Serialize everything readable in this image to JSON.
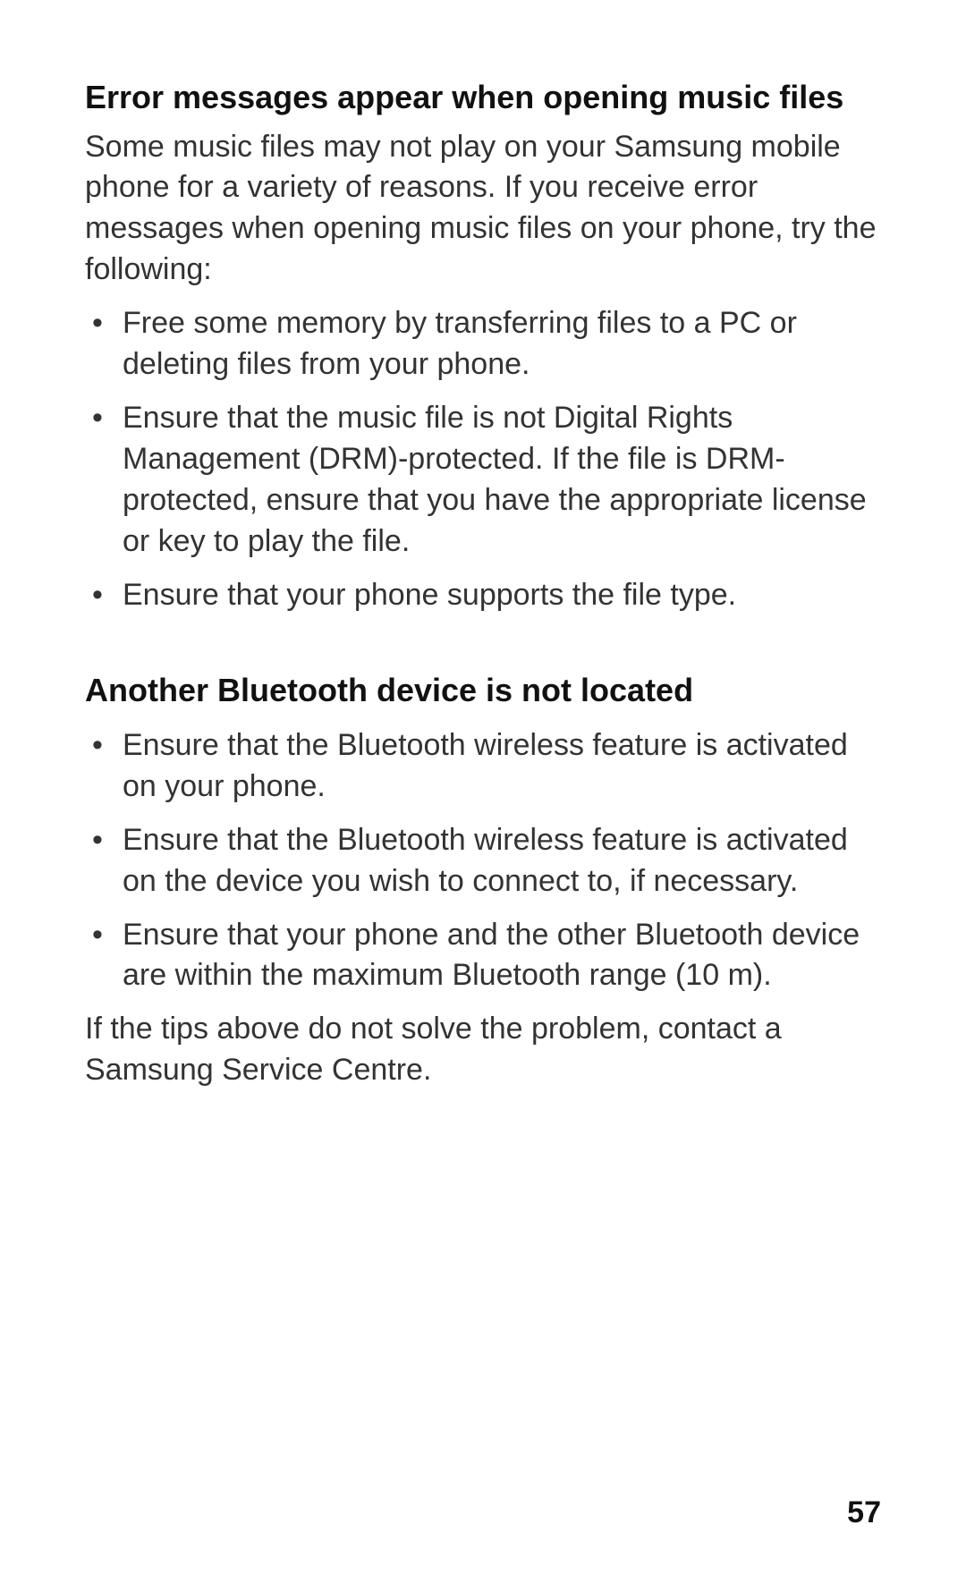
{
  "section1": {
    "heading": "Error messages appear when opening music files",
    "intro": "Some music files may not play on your Samsung mobile phone for a variety of reasons. If you receive error messages when opening music files on your phone, try the following:",
    "bullets": [
      "Free some memory by transferring files to a PC or deleting files from your phone.",
      "Ensure that the music file is not Digital Rights Management (DRM)-protected. If the file is DRM-protected, ensure that you have the appropriate license or key to play the file.",
      "Ensure that your phone supports the file type."
    ]
  },
  "section2": {
    "heading": "Another Bluetooth device is not located",
    "bullets": [
      "Ensure that the Bluetooth wireless feature is activated on your phone.",
      "Ensure that the Bluetooth wireless feature is activated on the device you wish to connect to, if necessary.",
      "Ensure that your phone and the other Bluetooth device are within the maximum Bluetooth range (10 m)."
    ],
    "closing": "If the tips above do not solve the problem, contact a Samsung Service Centre."
  },
  "page_number": "57"
}
